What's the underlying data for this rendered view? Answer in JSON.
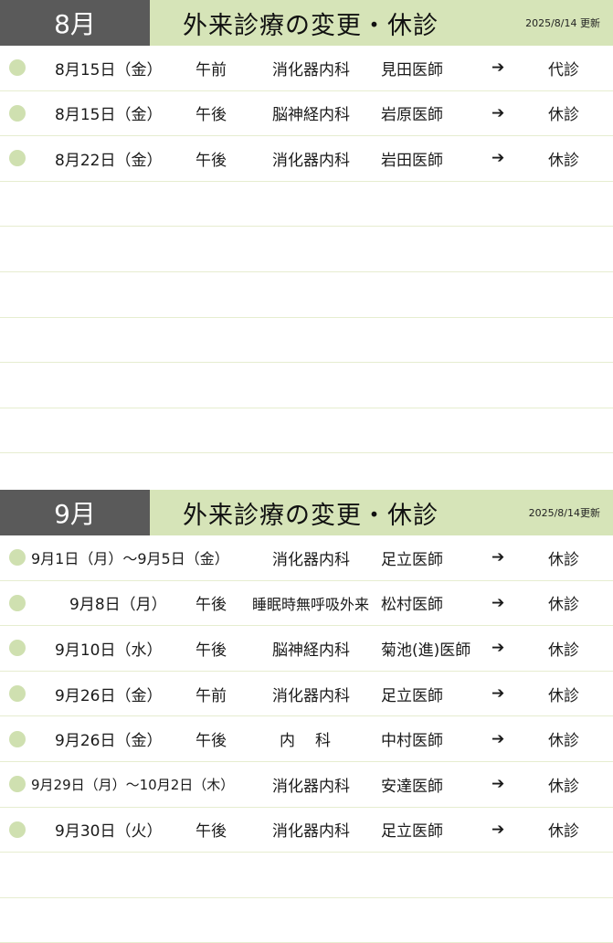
{
  "sections": [
    {
      "month": "8月",
      "title": "外来診療の変更・休診",
      "updated": "2025/8/14 更新",
      "rows": [
        {
          "date": "8月15日（金）",
          "time": "午前",
          "dept": "消化器内科",
          "doctor": "見田医師",
          "arrow": "➔",
          "status": "代診"
        },
        {
          "date": "8月15日（金）",
          "time": "午後",
          "dept": "脳神経内科",
          "doctor": "岩原医師",
          "arrow": "➔",
          "status": "休診"
        },
        {
          "date": "8月22日（金）",
          "time": "午後",
          "dept": "消化器内科",
          "doctor": "岩田医師",
          "arrow": "➔",
          "status": "休診"
        }
      ]
    },
    {
      "month": "9月",
      "title": "外来診療の変更・休診",
      "updated": "2025/8/14更新",
      "rows": [
        {
          "date": "9月1日（月）〜9月5日（金）",
          "time": "",
          "dept": "消化器内科",
          "doctor": "足立医師",
          "arrow": "➔",
          "status": "休診"
        },
        {
          "date": "9月8日（月）",
          "time": "午後",
          "dept": "睡眠時無呼吸外来",
          "doctor": "松村医師",
          "arrow": "➔",
          "status": "休診"
        },
        {
          "date": "9月10日（水）",
          "time": "午後",
          "dept": "脳神経内科",
          "doctor": "菊池(進)医師",
          "arrow": "➔",
          "status": "休診"
        },
        {
          "date": "9月26日（金）",
          "time": "午前",
          "dept": "消化器内科",
          "doctor": "足立医師",
          "arrow": "➔",
          "status": "休診"
        },
        {
          "date": "9月26日（金）",
          "time": "午後",
          "dept": "内科",
          "doctor": "中村医師",
          "arrow": "➔",
          "status": "休診"
        },
        {
          "date": "9月29日（月）〜10月2日（木）",
          "time": "",
          "dept": "消化器内科",
          "doctor": "安達医師",
          "arrow": "➔",
          "status": "休診"
        },
        {
          "date": "9月30日（火）",
          "time": "午後",
          "dept": "消化器内科",
          "doctor": "足立医師",
          "arrow": "➔",
          "status": "休診"
        }
      ]
    }
  ]
}
